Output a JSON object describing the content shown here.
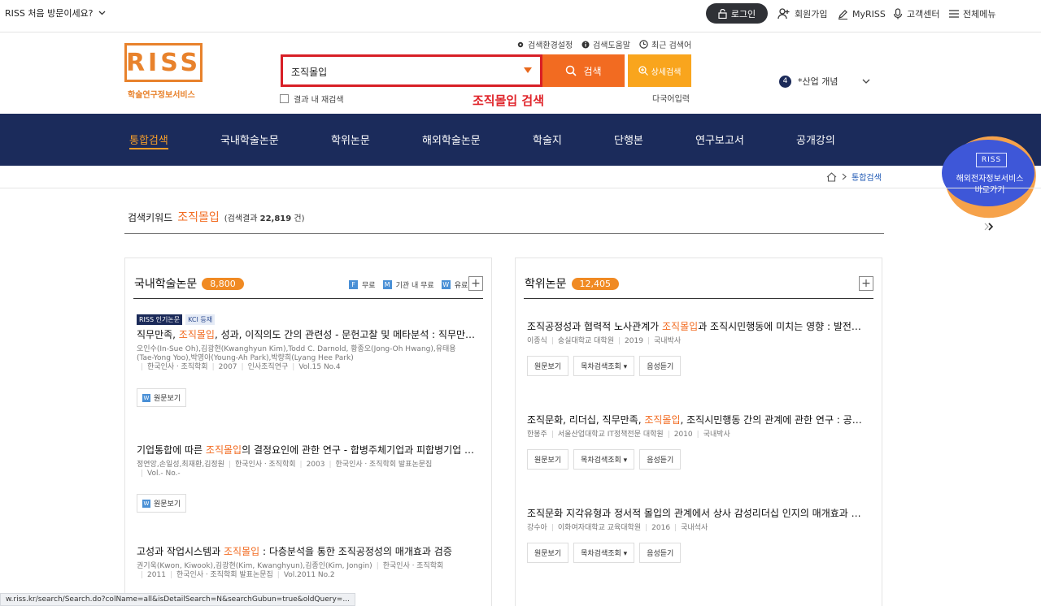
{
  "topbar": {
    "first_visit": "RISS 처음 방문이세요?",
    "login": "로그인",
    "signup": "회원가입",
    "myriss": "MyRISS",
    "support": "고객센터",
    "all_menu": "전체메뉴"
  },
  "logo": {
    "mark": "RISS",
    "subtitle": "학술연구정보서비스"
  },
  "search": {
    "settings": "검색환경설정",
    "help": "검색도움말",
    "recent": "최근 검색어",
    "query": "조직몰입",
    "button": "검색",
    "detail": "상세검색",
    "within_results": "결과 내 재검색",
    "multilang": "다국어입력",
    "annotation": "조직몰입 검색"
  },
  "trend": {
    "rank": "4",
    "term": "*산업 개념"
  },
  "nav": {
    "items": [
      "통합검색",
      "국내학술논문",
      "학위논문",
      "해외학술논문",
      "학술지",
      "단행본",
      "연구보고서",
      "공개강의"
    ]
  },
  "overseas": {
    "mark": "RISS",
    "line1": "해외전자정보서비스",
    "line2": "바로가기"
  },
  "breadcrumb": {
    "current": "통합검색"
  },
  "keyword": {
    "label": "검색키워드",
    "value": "조직몰입",
    "result_prefix": "(검색결과",
    "result_count": "22,819",
    "result_suffix": "건)"
  },
  "domestic": {
    "title": "국내학술논문",
    "count": "8,800",
    "legend_free": "무료",
    "legend_inst": "기관 내 무료",
    "legend_paid": "유료",
    "fulltext_label": "원문보기",
    "items": [
      {
        "badge1": "RISS 인기논문",
        "badge2": "KCI 등재",
        "title_pre": "직무만족, ",
        "title_hl": "조직몰입",
        "title_post": ", 성과, 이직의도 간의 관련성 - 문헌고찰 및 메타분석 : 직무만족, 조직몰입, 성과, 이직의도 간의 관련성",
        "meta1": "오인수(In-Sue Oh),김광현(Kwanghyun Kim),Todd C. Darnold, 황종오(Jong-Oh Hwang),유태용",
        "meta2": "(Tae-Yong Yoo),박영아(Young-Ah Park),박량희(Lyang Hee Park)",
        "meta3a": "한국인사ㆍ조직학회",
        "meta3b": "2007",
        "meta3c": "인사조직연구",
        "meta3d": "Vol.15 No.4"
      },
      {
        "title_pre": "기업통합에 따른 ",
        "title_hl": "조직몰입",
        "title_post": "의 결정요인에 관한 연구 - 합병주체기업과 피합병기업 비교",
        "meta1a": "정연앙,손일성,최재환,김정원",
        "meta1b": "한국인사ㆍ조직학회",
        "meta1c": "2003",
        "meta1d": "한국인사ㆍ조직학회 발표논문집",
        "meta2": "Vol.- No.-"
      },
      {
        "title_pre": "고성과 작업시스템과 ",
        "title_hl": "조직몰입",
        "title_post": " : 다층분석을 통한 조직공정성의 매개효과 검증",
        "meta1a": "권기욱(Kwon, Kiwook),김광현(Kim, Kwanghyun),김종인(Kim, Jongin)",
        "meta1b": "한국인사ㆍ조직학회",
        "meta2a": "2011",
        "meta2b": "한국인사ㆍ조직학회 발표논문집",
        "meta2c": "Vol.2011 No.2"
      }
    ]
  },
  "thesis": {
    "title": "학위논문",
    "count": "12,405",
    "btn_view": "원문보기",
    "btn_toc": "목차검색조회",
    "btn_audio": "음성듣기",
    "items": [
      {
        "title_pre": "조직공정성과 협력적 노사관계가 ",
        "title_hl": "조직몰입",
        "title_post": "과 조직시민행동에 미치는 영향 : 발전회사를 중심으로",
        "author": "이종식",
        "school": "숭실대학교 대학원",
        "year": "2019",
        "degree": "국내박사"
      },
      {
        "title_pre": "조직문화, 리더십, 직무만족, ",
        "title_hl": "조직몰입",
        "title_post": ", 조직시민행동 간의 관계에 관한 연구 : 공공조직을 중심으로",
        "author": "한봉주",
        "school": "서울산업대학교 IT정책전문 대학원",
        "year": "2010",
        "degree": "국내박사"
      },
      {
        "title_pre": "조직문화 지각유형과 정서적 몰입의 관계에서 상사 감성리더십 인지의 매개효과 검증",
        "title_hl": "",
        "title_post": "",
        "author": "강수아",
        "school": "이화여자대학교 교육대학원",
        "year": "2016",
        "degree": "국내석사"
      }
    ]
  },
  "statusbar": {
    "url": "w.riss.kr/search/Search.do?colName=all&isDetailSearch=N&searchGubun=true&oldQuery=..."
  },
  "colors": {
    "accent": "#f26b21",
    "nav": "#1b2b5b",
    "highlight_red": "#e0262c"
  }
}
